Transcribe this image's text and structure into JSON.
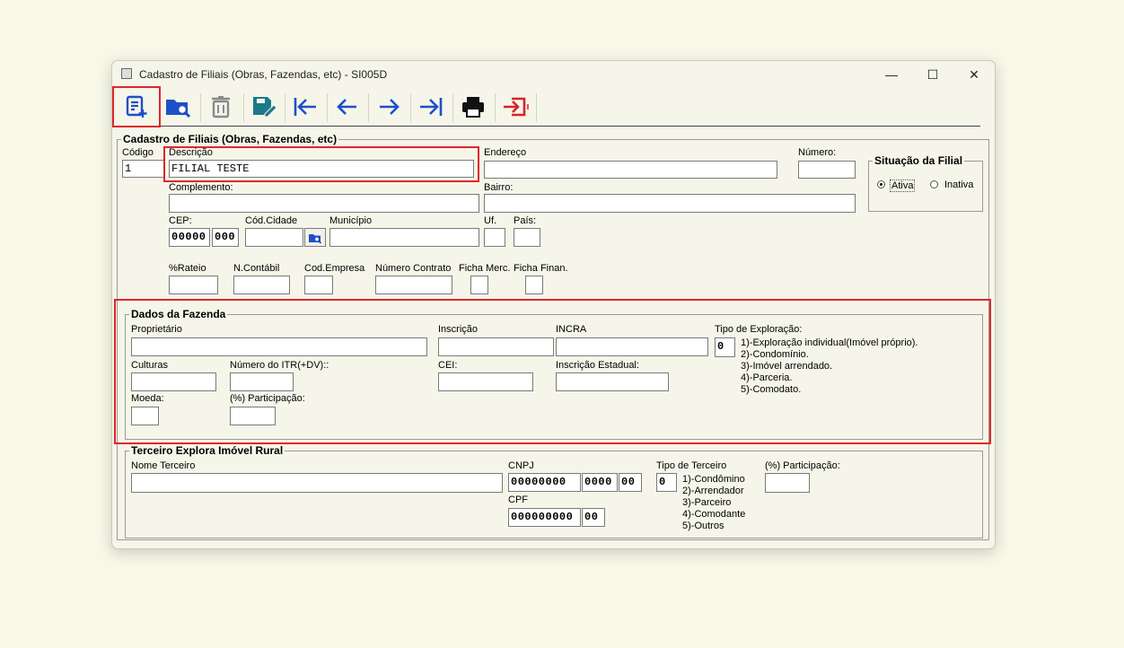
{
  "window": {
    "title": "Cadastro de Filiais (Obras, Fazendas, etc) - SI005D",
    "minimize_glyph": "—",
    "maximize_glyph": "☐",
    "close_glyph": "✕"
  },
  "toolbar": [
    {
      "name": "new-record-button",
      "icon": "new-document-icon"
    },
    {
      "name": "search-button",
      "icon": "folder-search-icon"
    },
    {
      "name": "delete-button",
      "icon": "trash-icon"
    },
    {
      "name": "save-edit-button",
      "icon": "save-edit-icon"
    },
    {
      "name": "first-record-button",
      "icon": "first-arrow-icon"
    },
    {
      "name": "previous-record-button",
      "icon": "left-arrow-icon"
    },
    {
      "name": "next-record-button",
      "icon": "right-arrow-icon"
    },
    {
      "name": "last-record-button",
      "icon": "last-arrow-icon"
    },
    {
      "name": "print-button",
      "icon": "printer-icon"
    },
    {
      "name": "exit-button",
      "icon": "exit-icon"
    }
  ],
  "cadastro": {
    "legend": "Cadastro de Filiais (Obras, Fazendas, etc)",
    "codigo_label": "Código",
    "codigo_value": "1",
    "descricao_label": "Descrição",
    "descricao_value": "FILIAL TESTE",
    "endereco_label": "Endereço",
    "numero_label": "Número:",
    "complemento_label": "Complemento:",
    "bairro_label": "Bairro:",
    "cep_label": "CEP:",
    "cep_part1": "00000",
    "cep_part2": "000",
    "cod_cidade_label": "Cód.Cidade",
    "municipio_label": "Município",
    "uf_label": "Uf.",
    "pais_label": "País:",
    "rateio_label": "%Rateio",
    "ncontabil_label": "N.Contábil",
    "cod_empresa_label": "Cod.Empresa",
    "numero_contrato_label": "Número Contrato",
    "ficha_merc_label": "Ficha Merc.",
    "ficha_finan_label": "Ficha Finan."
  },
  "situacao": {
    "legend": "Situação da Filial",
    "ativa": "Ativa",
    "inativa": "Inativa",
    "selected": "Ativa"
  },
  "fazenda": {
    "legend": "Dados da Fazenda",
    "proprietario_label": "Proprietário",
    "inscricao_label": "Inscrição",
    "incra_label": "INCRA",
    "tipo_exploracao_label": "Tipo de Exploração:",
    "tipo_exploracao_value": "0",
    "tipo_exploracao_options": [
      "1)-Exploração individual(Imóvel próprio).",
      "2)-Condomínio.",
      "3)-Imóvel arrendado.",
      "4)-Parceria.",
      "5)-Comodato."
    ],
    "culturas_label": "Culturas",
    "numero_itr_label": "Número do ITR(+DV)::",
    "cei_label": "CEI:",
    "inscricao_estadual_label": "Inscrição Estadual:",
    "moeda_label": "Moeda:",
    "participacao_label": "(%) Participação:"
  },
  "terceiro": {
    "legend": "Terceiro Explora Imóvel Rural",
    "nome_label": "Nome Terceiro",
    "cnpj_label": "CNPJ",
    "cnpj_part1": "00000000",
    "cnpj_part2": "0000",
    "cnpj_part3": "00",
    "cpf_label": "CPF",
    "cpf_part1": "000000000",
    "cpf_part2": "00",
    "tipo_label": "Tipo de Terceiro",
    "tipo_value": "0",
    "tipo_options": [
      "1)-Condômino",
      "2)-Arrendador",
      "3)-Parceiro",
      "4)-Comodante",
      "5)-Outros"
    ],
    "participacao_label": "(%) Participação:"
  },
  "colors": {
    "highlight": "#e0262b",
    "icon_blue": "#1f4fc8",
    "icon_teal": "#1b7a8a",
    "icon_red": "#d8232a"
  }
}
